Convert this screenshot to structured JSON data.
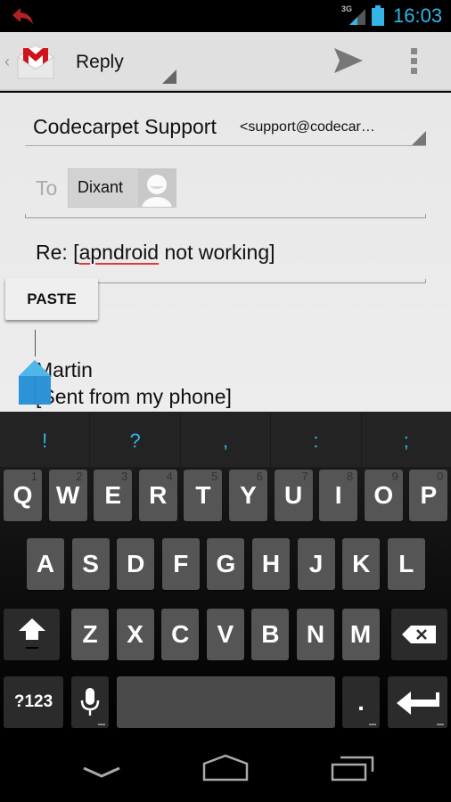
{
  "status_bar": {
    "notification_icon": "reply-arrow-icon",
    "network_type": "3G",
    "time": "16:03",
    "accent_color": "#33b5e5"
  },
  "action_bar": {
    "app_icon": "gmail-icon",
    "title": "Reply",
    "send_icon": "send-icon",
    "overflow_icon": "overflow-menu-icon"
  },
  "compose": {
    "from_name": "Codecarpet Support",
    "from_email": "<support@codecar…",
    "to_label": "To",
    "recipients": [
      {
        "name": "Dixant"
      }
    ],
    "subject_prefix": "Re: [",
    "subject_misspelled": "apndroid",
    "subject_suffix": " not working]",
    "body_lines": [
      "Martin",
      "[Sent from my phone]"
    ],
    "context_menu": {
      "paste_label": "PASTE"
    }
  },
  "keyboard": {
    "suggestions": [
      "!",
      "?",
      ",",
      ":",
      ";"
    ],
    "row1": [
      {
        "label": "Q",
        "hint": "1"
      },
      {
        "label": "W",
        "hint": "2"
      },
      {
        "label": "E",
        "hint": "3"
      },
      {
        "label": "R",
        "hint": "4"
      },
      {
        "label": "T",
        "hint": "5"
      },
      {
        "label": "Y",
        "hint": "6"
      },
      {
        "label": "U",
        "hint": "7"
      },
      {
        "label": "I",
        "hint": "8"
      },
      {
        "label": "O",
        "hint": "9"
      },
      {
        "label": "P",
        "hint": "0"
      }
    ],
    "row2": [
      "A",
      "S",
      "D",
      "F",
      "G",
      "H",
      "J",
      "K",
      "L"
    ],
    "row3": [
      "Z",
      "X",
      "C",
      "V",
      "B",
      "N",
      "M"
    ],
    "symbols_label": "?123",
    "period_label": "."
  },
  "nav_bar": {
    "back_icon": "back-chevron-icon",
    "home_icon": "home-icon",
    "recents_icon": "recent-apps-icon"
  }
}
